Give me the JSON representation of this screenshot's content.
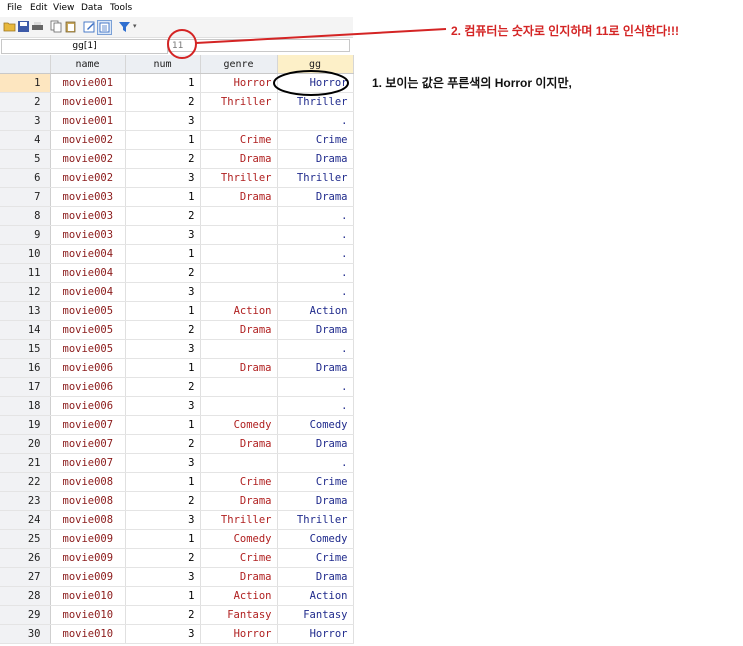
{
  "menu": [
    "File",
    "Edit",
    "View",
    "Data",
    "Tools"
  ],
  "toolbar_icons": [
    "open-icon",
    "save-icon",
    "print-icon",
    "copy-icon",
    "paste-icon",
    "edit-icon",
    "browse-icon",
    "filter-icon"
  ],
  "command_bar": {
    "varname": "gg[1]",
    "value": "11"
  },
  "columns": [
    "name",
    "num",
    "genre",
    "gg"
  ],
  "rows": [
    {
      "n": "1",
      "name": "movie001",
      "num": "1",
      "genre": "Horror",
      "gg": "Horror"
    },
    {
      "n": "2",
      "name": "movie001",
      "num": "2",
      "genre": "Thriller",
      "gg": "Thriller"
    },
    {
      "n": "3",
      "name": "movie001",
      "num": "3",
      "genre": "",
      "gg": "."
    },
    {
      "n": "4",
      "name": "movie002",
      "num": "1",
      "genre": "Crime",
      "gg": "Crime"
    },
    {
      "n": "5",
      "name": "movie002",
      "num": "2",
      "genre": "Drama",
      "gg": "Drama"
    },
    {
      "n": "6",
      "name": "movie002",
      "num": "3",
      "genre": "Thriller",
      "gg": "Thriller"
    },
    {
      "n": "7",
      "name": "movie003",
      "num": "1",
      "genre": "Drama",
      "gg": "Drama"
    },
    {
      "n": "8",
      "name": "movie003",
      "num": "2",
      "genre": "",
      "gg": "."
    },
    {
      "n": "9",
      "name": "movie003",
      "num": "3",
      "genre": "",
      "gg": "."
    },
    {
      "n": "10",
      "name": "movie004",
      "num": "1",
      "genre": "",
      "gg": "."
    },
    {
      "n": "11",
      "name": "movie004",
      "num": "2",
      "genre": "",
      "gg": "."
    },
    {
      "n": "12",
      "name": "movie004",
      "num": "3",
      "genre": "",
      "gg": "."
    },
    {
      "n": "13",
      "name": "movie005",
      "num": "1",
      "genre": "Action",
      "gg": "Action"
    },
    {
      "n": "14",
      "name": "movie005",
      "num": "2",
      "genre": "Drama",
      "gg": "Drama"
    },
    {
      "n": "15",
      "name": "movie005",
      "num": "3",
      "genre": "",
      "gg": "."
    },
    {
      "n": "16",
      "name": "movie006",
      "num": "1",
      "genre": "Drama",
      "gg": "Drama"
    },
    {
      "n": "17",
      "name": "movie006",
      "num": "2",
      "genre": "",
      "gg": "."
    },
    {
      "n": "18",
      "name": "movie006",
      "num": "3",
      "genre": "",
      "gg": "."
    },
    {
      "n": "19",
      "name": "movie007",
      "num": "1",
      "genre": "Comedy",
      "gg": "Comedy"
    },
    {
      "n": "20",
      "name": "movie007",
      "num": "2",
      "genre": "Drama",
      "gg": "Drama"
    },
    {
      "n": "21",
      "name": "movie007",
      "num": "3",
      "genre": "",
      "gg": "."
    },
    {
      "n": "22",
      "name": "movie008",
      "num": "1",
      "genre": "Crime",
      "gg": "Crime"
    },
    {
      "n": "23",
      "name": "movie008",
      "num": "2",
      "genre": "Drama",
      "gg": "Drama"
    },
    {
      "n": "24",
      "name": "movie008",
      "num": "3",
      "genre": "Thriller",
      "gg": "Thriller"
    },
    {
      "n": "25",
      "name": "movie009",
      "num": "1",
      "genre": "Comedy",
      "gg": "Comedy"
    },
    {
      "n": "26",
      "name": "movie009",
      "num": "2",
      "genre": "Crime",
      "gg": "Crime"
    },
    {
      "n": "27",
      "name": "movie009",
      "num": "3",
      "genre": "Drama",
      "gg": "Drama"
    },
    {
      "n": "28",
      "name": "movie010",
      "num": "1",
      "genre": "Action",
      "gg": "Action"
    },
    {
      "n": "29",
      "name": "movie010",
      "num": "2",
      "genre": "Fantasy",
      "gg": "Fantasy"
    },
    {
      "n": "30",
      "name": "movie010",
      "num": "3",
      "genre": "Horror",
      "gg": "Horror"
    }
  ],
  "annotations": {
    "note1": "1. 보이는 값은 푸른색의 Horror 이지만,",
    "note2": "2. 컴퓨터는 숫자로 인지하며 11로 인식한다!!!"
  },
  "colors": {
    "string_text": "#8b1a1a",
    "labeled_value": "#1f2a8c",
    "annotation_red": "#d42424"
  }
}
